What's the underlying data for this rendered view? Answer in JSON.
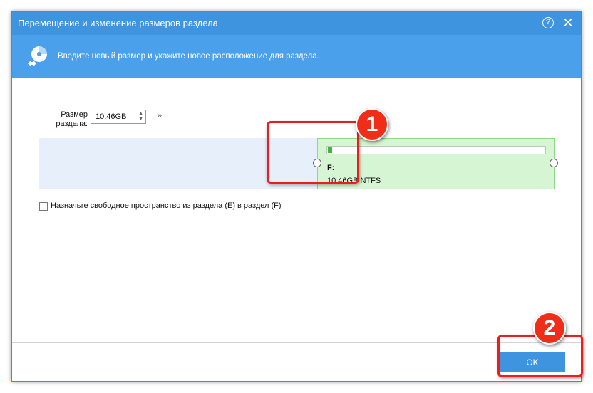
{
  "window": {
    "title": "Перемещение и изменение размеров раздела",
    "help_label": "?",
    "close_label": "✕"
  },
  "banner": {
    "text": "Введите новый размер и укажите новое расположение для раздела.",
    "icon": "disk-resize-icon"
  },
  "size": {
    "label_line1": "Размер",
    "label_line2": "раздела:",
    "value": "10.46GB",
    "spin_up": "▲",
    "spin_down": "▼",
    "expand": "»"
  },
  "partition": {
    "letter": "F:",
    "info": "10.46GB NTFS",
    "used_fraction": 0.02,
    "fill_color": "#3fb83a"
  },
  "checkbox": {
    "label": "Назначьте свободное пространство из раздела (E) в раздел (F)",
    "checked": false
  },
  "footer": {
    "ok_label": "OK"
  },
  "annotations": {
    "callout_1": "1",
    "callout_2": "2",
    "color": "#ee1d1d"
  }
}
